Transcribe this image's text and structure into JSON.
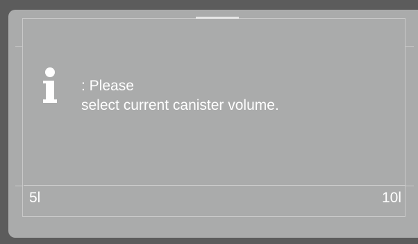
{
  "message": {
    "icon": "info-icon",
    "line1": ": Please",
    "line2": "select current canister volume."
  },
  "scale": {
    "min_label": "5l",
    "max_label": "10l"
  },
  "colors": {
    "bezel": "#5c5c5c",
    "screen": "#aaabab",
    "text": "#ffffff",
    "frame_line": "#c9c9c9"
  }
}
